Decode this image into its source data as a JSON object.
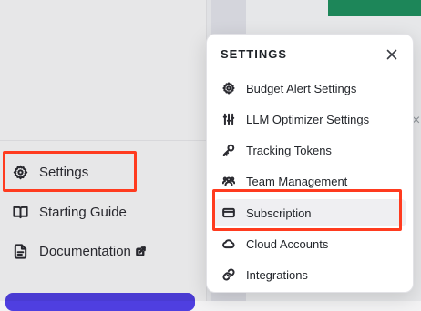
{
  "sidebar": {
    "items": [
      {
        "label": "Settings",
        "icon": "gear-icon"
      },
      {
        "label": "Starting Guide",
        "icon": "book-icon"
      },
      {
        "label": "Documentation",
        "icon": "document-icon"
      }
    ]
  },
  "settings_popover": {
    "title": "SETTINGS",
    "close_icon": "close-icon",
    "items": [
      {
        "label": "Budget Alert Settings",
        "icon": "gear-icon"
      },
      {
        "label": "LLM Optimizer Settings",
        "icon": "sliders-icon"
      },
      {
        "label": "Tracking Tokens",
        "icon": "key-icon"
      },
      {
        "label": "Team Management",
        "icon": "users-icon"
      },
      {
        "label": "Subscription",
        "icon": "credit-card-icon"
      },
      {
        "label": "Cloud Accounts",
        "icon": "cloud-icon"
      },
      {
        "label": "Integrations",
        "icon": "link-icon"
      }
    ]
  },
  "colors": {
    "highlight": "#ff3b1f",
    "accent": "#4f3fe0",
    "green": "#1f8f5f"
  }
}
